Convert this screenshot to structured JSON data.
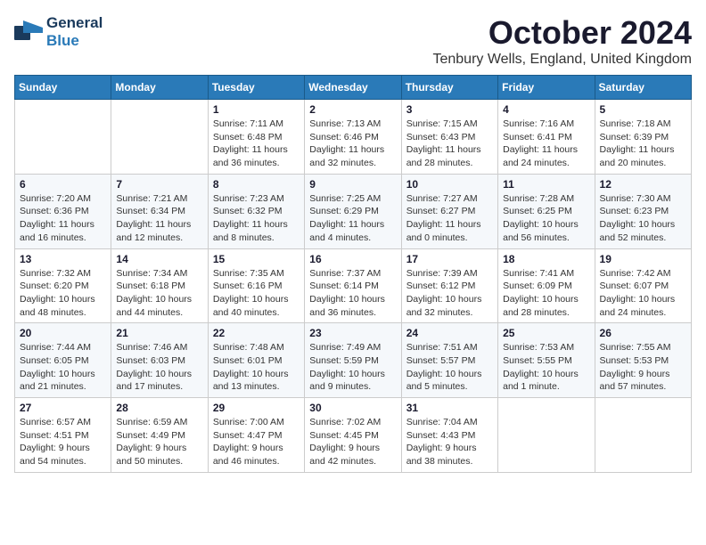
{
  "header": {
    "logo_general": "General",
    "logo_blue": "Blue",
    "month_title": "October 2024",
    "location": "Tenbury Wells, England, United Kingdom"
  },
  "days_of_week": [
    "Sunday",
    "Monday",
    "Tuesday",
    "Wednesday",
    "Thursday",
    "Friday",
    "Saturday"
  ],
  "weeks": [
    [
      {
        "day": "",
        "sunrise": "",
        "sunset": "",
        "daylight": ""
      },
      {
        "day": "",
        "sunrise": "",
        "sunset": "",
        "daylight": ""
      },
      {
        "day": "1",
        "sunrise": "Sunrise: 7:11 AM",
        "sunset": "Sunset: 6:48 PM",
        "daylight": "Daylight: 11 hours and 36 minutes."
      },
      {
        "day": "2",
        "sunrise": "Sunrise: 7:13 AM",
        "sunset": "Sunset: 6:46 PM",
        "daylight": "Daylight: 11 hours and 32 minutes."
      },
      {
        "day": "3",
        "sunrise": "Sunrise: 7:15 AM",
        "sunset": "Sunset: 6:43 PM",
        "daylight": "Daylight: 11 hours and 28 minutes."
      },
      {
        "day": "4",
        "sunrise": "Sunrise: 7:16 AM",
        "sunset": "Sunset: 6:41 PM",
        "daylight": "Daylight: 11 hours and 24 minutes."
      },
      {
        "day": "5",
        "sunrise": "Sunrise: 7:18 AM",
        "sunset": "Sunset: 6:39 PM",
        "daylight": "Daylight: 11 hours and 20 minutes."
      }
    ],
    [
      {
        "day": "6",
        "sunrise": "Sunrise: 7:20 AM",
        "sunset": "Sunset: 6:36 PM",
        "daylight": "Daylight: 11 hours and 16 minutes."
      },
      {
        "day": "7",
        "sunrise": "Sunrise: 7:21 AM",
        "sunset": "Sunset: 6:34 PM",
        "daylight": "Daylight: 11 hours and 12 minutes."
      },
      {
        "day": "8",
        "sunrise": "Sunrise: 7:23 AM",
        "sunset": "Sunset: 6:32 PM",
        "daylight": "Daylight: 11 hours and 8 minutes."
      },
      {
        "day": "9",
        "sunrise": "Sunrise: 7:25 AM",
        "sunset": "Sunset: 6:29 PM",
        "daylight": "Daylight: 11 hours and 4 minutes."
      },
      {
        "day": "10",
        "sunrise": "Sunrise: 7:27 AM",
        "sunset": "Sunset: 6:27 PM",
        "daylight": "Daylight: 11 hours and 0 minutes."
      },
      {
        "day": "11",
        "sunrise": "Sunrise: 7:28 AM",
        "sunset": "Sunset: 6:25 PM",
        "daylight": "Daylight: 10 hours and 56 minutes."
      },
      {
        "day": "12",
        "sunrise": "Sunrise: 7:30 AM",
        "sunset": "Sunset: 6:23 PM",
        "daylight": "Daylight: 10 hours and 52 minutes."
      }
    ],
    [
      {
        "day": "13",
        "sunrise": "Sunrise: 7:32 AM",
        "sunset": "Sunset: 6:20 PM",
        "daylight": "Daylight: 10 hours and 48 minutes."
      },
      {
        "day": "14",
        "sunrise": "Sunrise: 7:34 AM",
        "sunset": "Sunset: 6:18 PM",
        "daylight": "Daylight: 10 hours and 44 minutes."
      },
      {
        "day": "15",
        "sunrise": "Sunrise: 7:35 AM",
        "sunset": "Sunset: 6:16 PM",
        "daylight": "Daylight: 10 hours and 40 minutes."
      },
      {
        "day": "16",
        "sunrise": "Sunrise: 7:37 AM",
        "sunset": "Sunset: 6:14 PM",
        "daylight": "Daylight: 10 hours and 36 minutes."
      },
      {
        "day": "17",
        "sunrise": "Sunrise: 7:39 AM",
        "sunset": "Sunset: 6:12 PM",
        "daylight": "Daylight: 10 hours and 32 minutes."
      },
      {
        "day": "18",
        "sunrise": "Sunrise: 7:41 AM",
        "sunset": "Sunset: 6:09 PM",
        "daylight": "Daylight: 10 hours and 28 minutes."
      },
      {
        "day": "19",
        "sunrise": "Sunrise: 7:42 AM",
        "sunset": "Sunset: 6:07 PM",
        "daylight": "Daylight: 10 hours and 24 minutes."
      }
    ],
    [
      {
        "day": "20",
        "sunrise": "Sunrise: 7:44 AM",
        "sunset": "Sunset: 6:05 PM",
        "daylight": "Daylight: 10 hours and 21 minutes."
      },
      {
        "day": "21",
        "sunrise": "Sunrise: 7:46 AM",
        "sunset": "Sunset: 6:03 PM",
        "daylight": "Daylight: 10 hours and 17 minutes."
      },
      {
        "day": "22",
        "sunrise": "Sunrise: 7:48 AM",
        "sunset": "Sunset: 6:01 PM",
        "daylight": "Daylight: 10 hours and 13 minutes."
      },
      {
        "day": "23",
        "sunrise": "Sunrise: 7:49 AM",
        "sunset": "Sunset: 5:59 PM",
        "daylight": "Daylight: 10 hours and 9 minutes."
      },
      {
        "day": "24",
        "sunrise": "Sunrise: 7:51 AM",
        "sunset": "Sunset: 5:57 PM",
        "daylight": "Daylight: 10 hours and 5 minutes."
      },
      {
        "day": "25",
        "sunrise": "Sunrise: 7:53 AM",
        "sunset": "Sunset: 5:55 PM",
        "daylight": "Daylight: 10 hours and 1 minute."
      },
      {
        "day": "26",
        "sunrise": "Sunrise: 7:55 AM",
        "sunset": "Sunset: 5:53 PM",
        "daylight": "Daylight: 9 hours and 57 minutes."
      }
    ],
    [
      {
        "day": "27",
        "sunrise": "Sunrise: 6:57 AM",
        "sunset": "Sunset: 4:51 PM",
        "daylight": "Daylight: 9 hours and 54 minutes."
      },
      {
        "day": "28",
        "sunrise": "Sunrise: 6:59 AM",
        "sunset": "Sunset: 4:49 PM",
        "daylight": "Daylight: 9 hours and 50 minutes."
      },
      {
        "day": "29",
        "sunrise": "Sunrise: 7:00 AM",
        "sunset": "Sunset: 4:47 PM",
        "daylight": "Daylight: 9 hours and 46 minutes."
      },
      {
        "day": "30",
        "sunrise": "Sunrise: 7:02 AM",
        "sunset": "Sunset: 4:45 PM",
        "daylight": "Daylight: 9 hours and 42 minutes."
      },
      {
        "day": "31",
        "sunrise": "Sunrise: 7:04 AM",
        "sunset": "Sunset: 4:43 PM",
        "daylight": "Daylight: 9 hours and 38 minutes."
      },
      {
        "day": "",
        "sunrise": "",
        "sunset": "",
        "daylight": ""
      },
      {
        "day": "",
        "sunrise": "",
        "sunset": "",
        "daylight": ""
      }
    ]
  ]
}
